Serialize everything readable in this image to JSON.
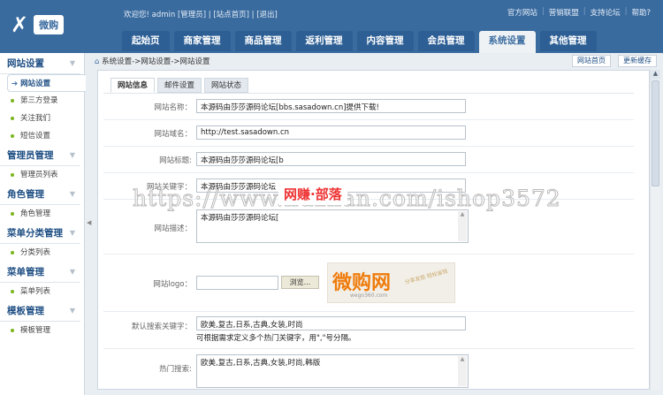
{
  "header": {
    "logo_text": "微购",
    "welcome": "欢迎您! admin [管理员] | [站点首页] | [退出]",
    "links": [
      "官方网站",
      "营销联盟",
      "支持论坛",
      "帮助?"
    ],
    "tabs": [
      "起始页",
      "商家管理",
      "商品管理",
      "返利管理",
      "内容管理",
      "会员管理",
      "系统设置",
      "其他管理"
    ]
  },
  "sidebar": [
    {
      "title": "网站设置",
      "items": [
        "网站设置",
        "第三方登录",
        "关注我们",
        "短信设置"
      ]
    },
    {
      "title": "管理员管理",
      "items": [
        "管理员列表"
      ]
    },
    {
      "title": "角色管理",
      "items": [
        "角色管理"
      ]
    },
    {
      "title": "菜单分类管理",
      "items": [
        "分类列表"
      ]
    },
    {
      "title": "菜单管理",
      "items": [
        "菜单列表"
      ]
    },
    {
      "title": "模板管理",
      "items": [
        "模板管理"
      ]
    }
  ],
  "breadcrumb": "系统设置->网站设置->网站设置",
  "buttons": {
    "site_home": "网站首页",
    "refresh_cache": "更新缓存",
    "browse": "浏览..."
  },
  "inner_tabs": [
    "网站信息",
    "邮件设置",
    "网站状态"
  ],
  "form": {
    "site_name": {
      "label": "网站名称：",
      "value": "本源码由莎莎源码论坛[bbs.sasadown.cn]提供下载!"
    },
    "site_domain": {
      "label": "网站域名：",
      "value": "http://test.sasadown.cn"
    },
    "site_title": {
      "label": "网站标题:",
      "value": "本源码由莎莎源码论坛[b"
    },
    "site_keywords": {
      "label": "网站关键字：",
      "value": "本源码由莎莎源码论坛"
    },
    "site_desc": {
      "label": "网站描述：",
      "value": "本源码由莎莎源码论坛["
    },
    "site_logo": {
      "label": "网站logo：",
      "value": "",
      "logo_text": "微购网",
      "logo_url": "wego360.com",
      "logo_slogan": "分享发现 轻松省钱"
    },
    "default_keywords": {
      "label": "默认搜索关键字：",
      "value": "欧美,复古,日系,古典,女装,时尚",
      "hint": "可根据需求定义多个热门关键字，用\",\"号分隔。"
    },
    "hot_search": {
      "label": "热门搜索:",
      "value": "欧美,复古,日系,古典,女装,时尚,韩版"
    }
  },
  "watermark": {
    "url": "https://www.huzhan.com/ishop3572",
    "logo": "网赚·部落"
  }
}
